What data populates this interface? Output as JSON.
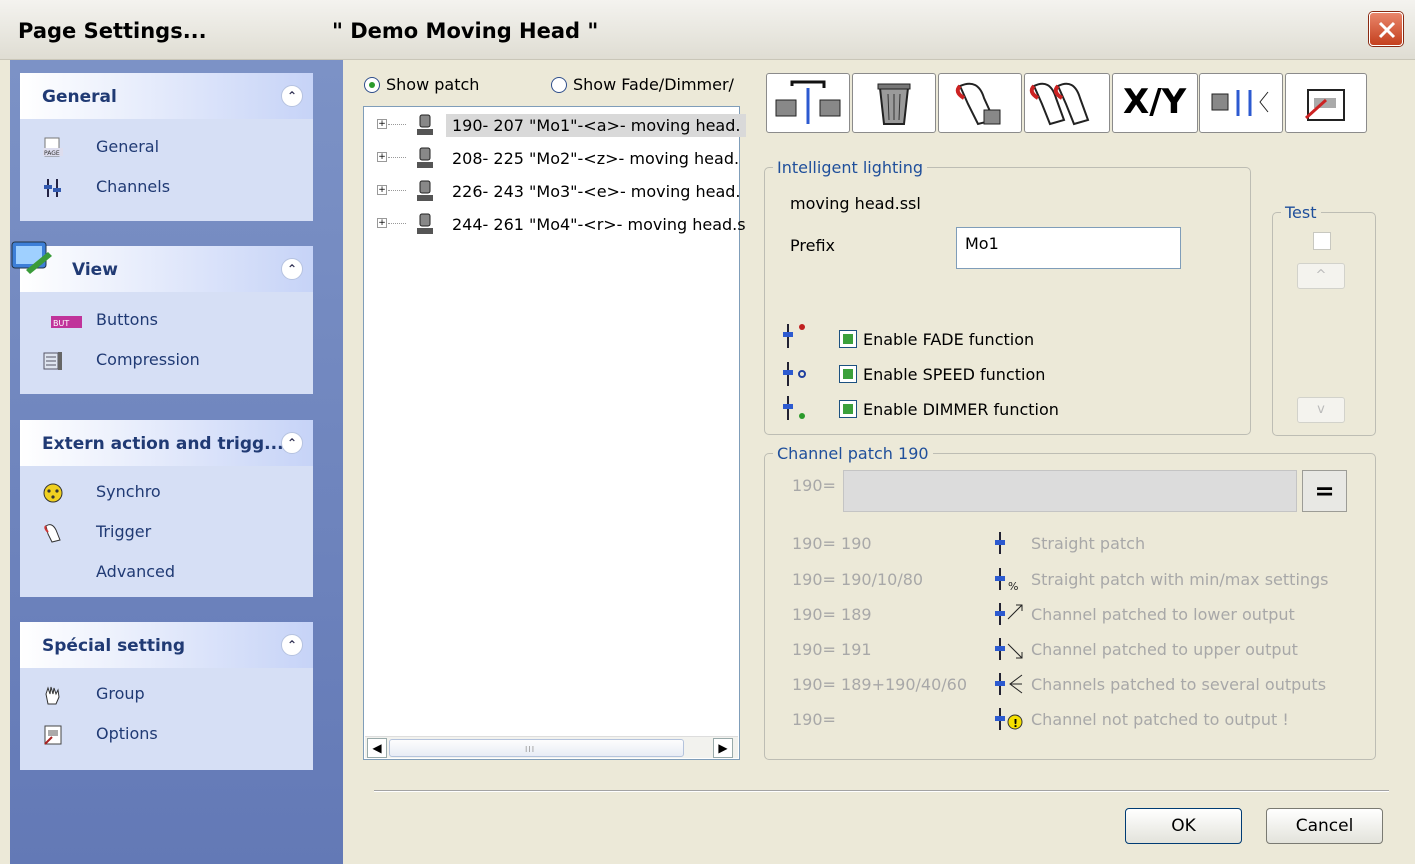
{
  "window": {
    "title": "Page  Settings...",
    "document_title": "\" Demo Moving Head \""
  },
  "sidebar": {
    "groups": [
      {
        "title": "General",
        "items": [
          {
            "label": "General",
            "icon": "page-icon"
          },
          {
            "label": "Channels",
            "icon": "channels-fader-icon"
          }
        ]
      },
      {
        "title": "View",
        "items": [
          {
            "label": "Buttons",
            "icon": "button-icon"
          },
          {
            "label": "Compression",
            "icon": "compression-icon"
          }
        ]
      },
      {
        "title": "Extern action and trigg...",
        "items": [
          {
            "label": "Synchro",
            "icon": "dmx-connector-icon"
          },
          {
            "label": "Trigger",
            "icon": "hand-icon"
          },
          {
            "label": "Advanced",
            "icon": ""
          }
        ]
      },
      {
        "title": "Spécial setting",
        "items": [
          {
            "label": "Group",
            "icon": "hand-pointer-icon"
          },
          {
            "label": "Options",
            "icon": "options-icon"
          }
        ]
      }
    ]
  },
  "view_mode": {
    "show_patch": "Show patch",
    "show_fade": "Show Fade/Dimmer/",
    "selected": "show_patch"
  },
  "patch_tree": {
    "rows": [
      "190- 207 \"Mo1\"-<a>- moving head.",
      "208- 225 \"Mo2\"-<z>- moving head.",
      "226- 243 \"Mo3\"-<e>- moving head.",
      "244- 261 \"Mo4\"-<r>- moving head.s"
    ],
    "selected_index": 0,
    "scroll_grip": "III"
  },
  "toolbar": {
    "xy_label": "X/Y"
  },
  "intelligent_lighting": {
    "legend": "Intelligent lighting",
    "file": "moving head.ssl",
    "prefix_label": "Prefix",
    "prefix_value": "Mo1",
    "enable_fade": "Enable FADE function",
    "enable_speed": "Enable SPEED function",
    "enable_dimmer": "Enable DIMMER function",
    "fade_checked": true,
    "speed_checked": true,
    "dimmer_checked": true
  },
  "test": {
    "legend": "Test",
    "up": "^",
    "down": "v"
  },
  "channel_patch": {
    "legend": "Channel patch 190",
    "input_label": "190=",
    "equals_button": "=",
    "examples": [
      {
        "code": "190= 190",
        "desc": "Straight patch"
      },
      {
        "code": "190= 190/10/80",
        "desc": "Straight patch with min/max settings"
      },
      {
        "code": "190= 189",
        "desc": "Channel patched to lower output"
      },
      {
        "code": "190= 191",
        "desc": "Channel patched to upper output"
      },
      {
        "code": "190= 189+190/40/60",
        "desc": "Channels patched to several outputs"
      },
      {
        "code": "190=",
        "desc": "Channel not patched to output !"
      }
    ]
  },
  "dialog_buttons": {
    "ok": "OK",
    "cancel": "Cancel"
  },
  "colors": {
    "sidebar_bg": "#6f86c0",
    "group_text": "#203a74",
    "legend_blue": "#1f4f9b",
    "close_red": "#d0502a"
  }
}
